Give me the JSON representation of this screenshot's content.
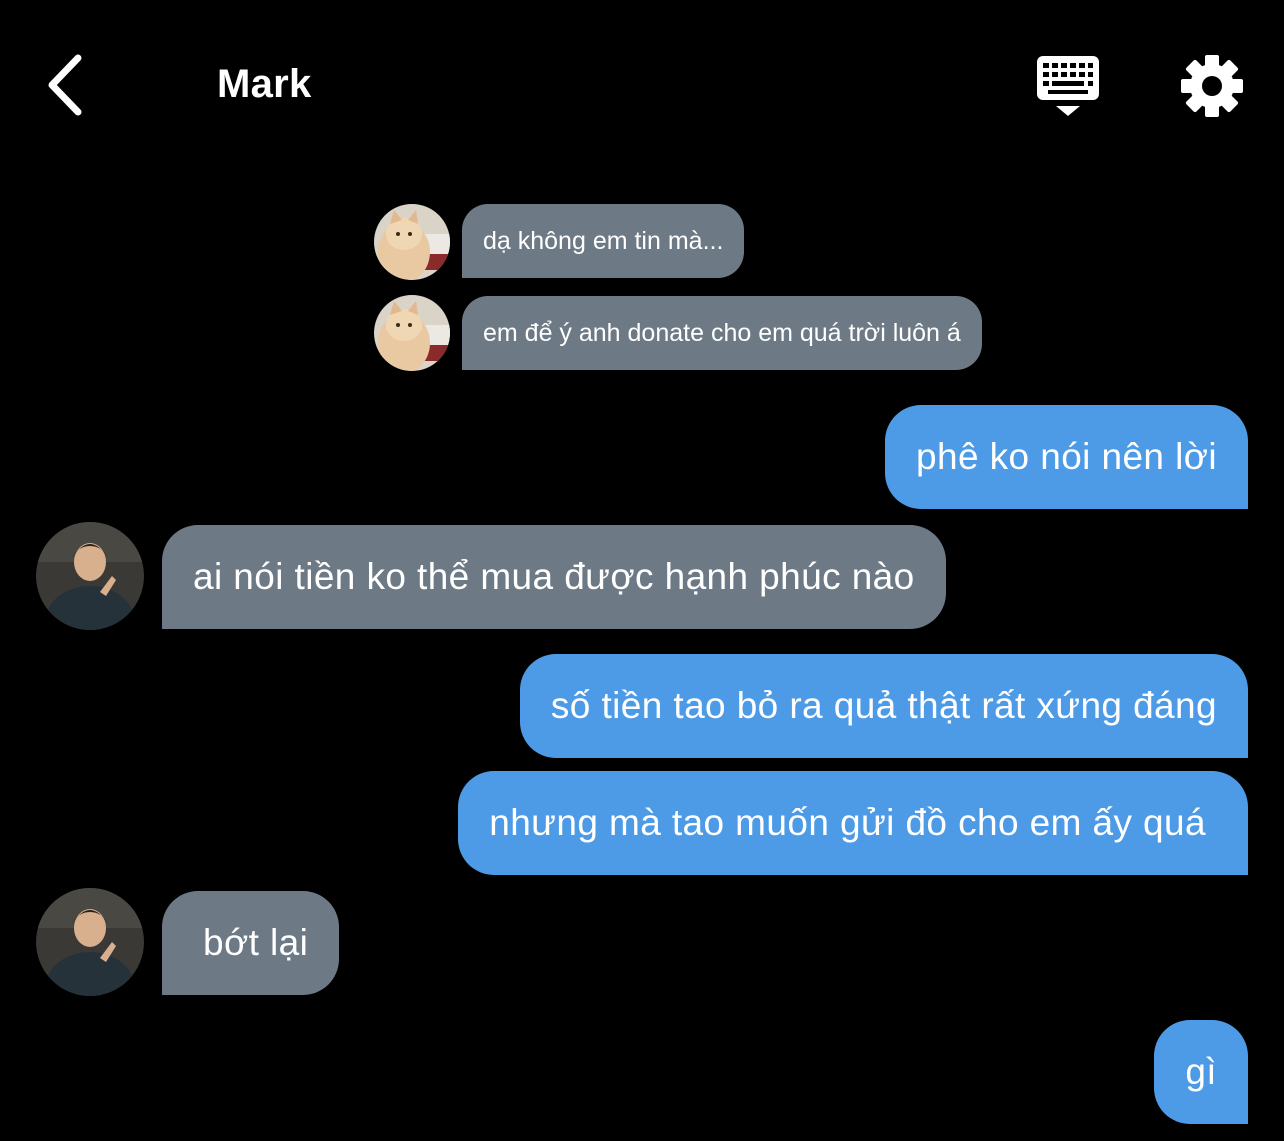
{
  "header": {
    "title": "Mark",
    "back_icon": "chevron-left-icon",
    "keyboard_icon": "keyboard-icon",
    "settings_icon": "gear-icon"
  },
  "colors": {
    "background": "#000000",
    "incoming_bubble": "#6d7a86",
    "outgoing_bubble": "#4d9be6",
    "text": "#ffffff"
  },
  "messages": [
    {
      "sender": "cat",
      "direction": "incoming",
      "text": "dạ không em tin mà..."
    },
    {
      "sender": "cat",
      "direction": "incoming",
      "text": "em để ý anh donate cho em quá trời luôn á"
    },
    {
      "sender": "me",
      "direction": "outgoing",
      "text": "phê ko nói nên lời"
    },
    {
      "sender": "mark",
      "direction": "incoming",
      "text": "ai nói tiền ko thể mua được hạnh phúc nào"
    },
    {
      "sender": "me",
      "direction": "outgoing",
      "text": "số tiền tao bỏ ra quả thật rất xứng đáng"
    },
    {
      "sender": "me",
      "direction": "outgoing",
      "text": "nhưng mà tao muốn gửi đồ cho em ấy quá"
    },
    {
      "sender": "mark",
      "direction": "incoming",
      "text": "bớt lại"
    },
    {
      "sender": "me",
      "direction": "outgoing",
      "text": "gì"
    }
  ]
}
